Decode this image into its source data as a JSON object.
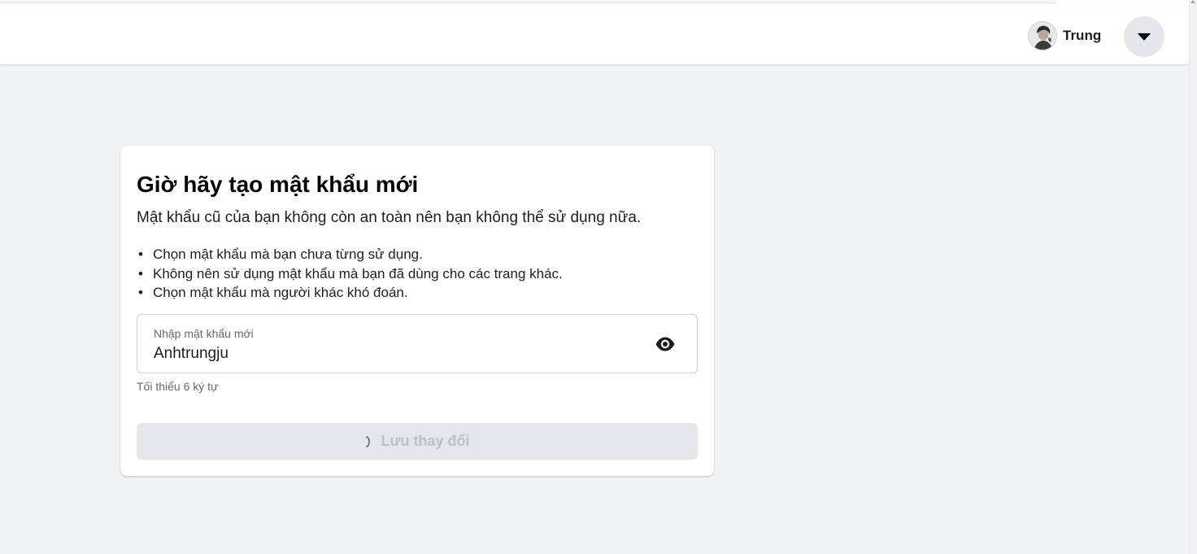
{
  "header": {
    "profile_name": "Trung",
    "avatar_icon": "avatar-photo",
    "menu_icon": "caret-down-icon"
  },
  "card": {
    "title": "Giờ hãy tạo mật khẩu mới",
    "subtitle": "Mật khẩu cũ của bạn không còn an toàn nên bạn không thể sử dụng nữa.",
    "tips": [
      "Chọn mật khẩu mà bạn chưa từng sử dụng.",
      "Không nên sử dụng mật khẩu mà bạn đã dùng cho các trang khác.",
      "Chọn mật khẩu mà người khác khó đoán."
    ],
    "password_field": {
      "label": "Nhập mật khẩu mới",
      "value": "Anhtrungju",
      "toggle_icon": "eye-icon"
    },
    "hint": "Tối thiểu 6 ký tự",
    "save_button": {
      "label": "Lưu thay đổi",
      "state": "loading",
      "icon": "spinner-icon"
    }
  },
  "colors": {
    "page_background": "#f0f2f5",
    "card_background": "#ffffff",
    "button_disabled": "#e4e6eb",
    "button_text_disabled": "#bcc0c4",
    "secondary_text": "#65676b"
  }
}
